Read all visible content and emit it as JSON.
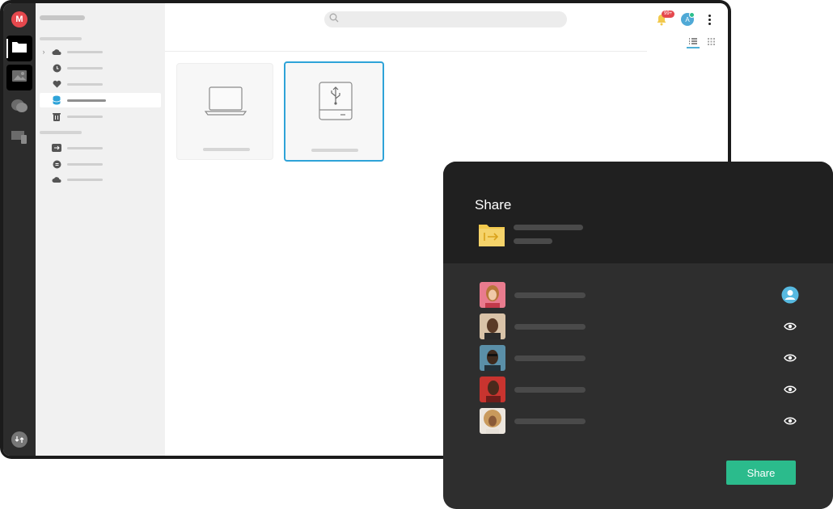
{
  "header": {
    "search": {
      "value": "",
      "placeholder": ""
    },
    "notifications": {
      "badge": "99+"
    },
    "account": {
      "initial": "A"
    }
  },
  "rail": {
    "logo_letter": "M",
    "items": [
      {
        "icon": "folder-icon",
        "active": true
      },
      {
        "icon": "photos-icon",
        "active": true
      },
      {
        "icon": "chat-icon",
        "active": false
      },
      {
        "icon": "devices-icon",
        "active": false
      }
    ],
    "bottom_icon": "sync-icon"
  },
  "sidebar": {
    "items": [
      {
        "icon": "cloud-drive-icon",
        "expandable": true,
        "active": false
      },
      {
        "icon": "recents-icon",
        "active": false
      },
      {
        "icon": "favourites-icon",
        "active": false
      },
      {
        "icon": "backups-icon",
        "active": true
      },
      {
        "icon": "rubbish-bin-icon",
        "active": false
      },
      {
        "icon": "shared-items-icon",
        "active": false
      },
      {
        "icon": "links-icon",
        "active": false
      },
      {
        "icon": "cloud-icon",
        "active": false
      }
    ]
  },
  "main": {
    "view_mode": "list",
    "tiles": [
      {
        "icon": "laptop-icon",
        "selected": false
      },
      {
        "icon": "usb-drive-icon",
        "selected": true
      }
    ]
  },
  "share_dialog": {
    "title": "Share",
    "folder_icon": "shared-folder-icon",
    "contacts": [
      {
        "avatar": "contact-avatar",
        "access": "owner-icon"
      },
      {
        "avatar": "contact-avatar",
        "access": "eye-icon"
      },
      {
        "avatar": "contact-avatar",
        "access": "eye-icon"
      },
      {
        "avatar": "contact-avatar",
        "access": "eye-icon"
      },
      {
        "avatar": "contact-avatar",
        "access": "eye-icon"
      }
    ],
    "share_label": "Share"
  },
  "colors": {
    "accent_red": "#e5484d",
    "accent_blue": "#2ea3d8",
    "accent_green": "#2bbb8c",
    "folder_yellow": "#f2c94c"
  }
}
